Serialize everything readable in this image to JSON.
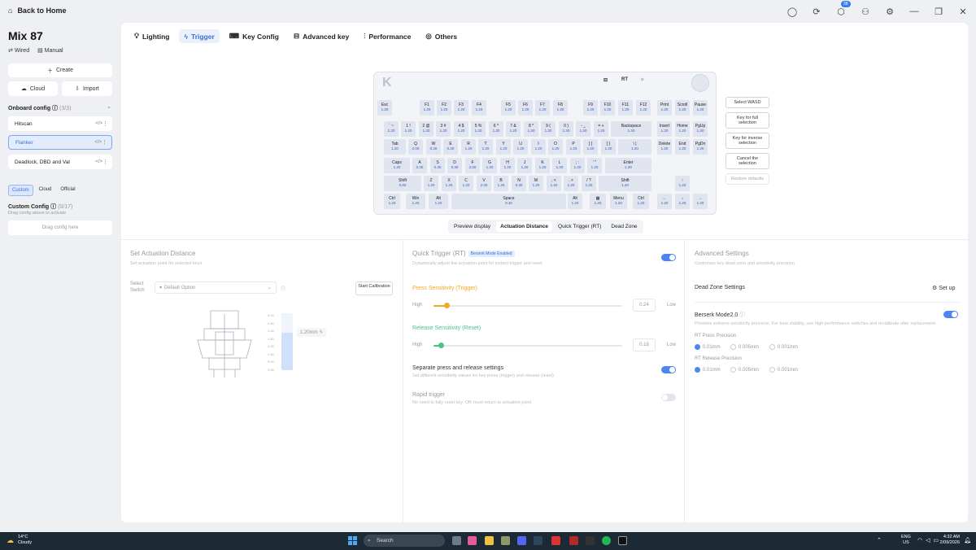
{
  "titlebar": {
    "back_label": "Back to Home",
    "notification_count": "38"
  },
  "sidebar": {
    "device_name": "Mix 87",
    "connection": "Wired",
    "manual": "Manual",
    "create_label": "Create",
    "cloud_label": "Cloud",
    "import_label": "Import",
    "onboard_config_label": "Onboard config",
    "onboard_config_count": "(3/3)",
    "configs": [
      "Hitscan",
      "Flanker",
      "Deadlock, DBD and Val"
    ],
    "filter_tabs": [
      "Custom",
      "Cloud",
      "Official"
    ],
    "custom_config_label": "Custom Config",
    "custom_config_count": "(0/17)",
    "custom_config_hint": "Drag config above to activate",
    "drag_hint": "Drag config here"
  },
  "tabs": [
    "Lighting",
    "Trigger",
    "Key Config",
    "Advanced key",
    "Performance",
    "Others"
  ],
  "keyboard": {
    "icon_labels": [
      "⊟",
      "RT",
      "☼"
    ],
    "rows": [
      [
        [
          "Esc",
          "1.20"
        ],
        [
          "F1",
          "1.20"
        ],
        [
          "F2",
          "1.20"
        ],
        [
          "F3",
          "1.20"
        ],
        [
          "F4",
          "1.20"
        ],
        [
          "F5",
          "1.20"
        ],
        [
          "F6",
          "1.20"
        ],
        [
          "F7",
          "1.20"
        ],
        [
          "F8",
          "1.20"
        ],
        [
          "F9",
          "1.20"
        ],
        [
          "F10",
          "1.20"
        ],
        [
          "F11",
          "1.20"
        ],
        [
          "F12",
          "1.20"
        ],
        [
          "Print",
          "1.20"
        ],
        [
          "Scroll",
          "1.20"
        ],
        [
          "Pause",
          "1.20"
        ]
      ],
      [
        [
          "` ~",
          "1.20"
        ],
        [
          "1 !",
          "1.20"
        ],
        [
          "2 @",
          "1.20"
        ],
        [
          "3 #",
          "1.20"
        ],
        [
          "4 $",
          "1.20"
        ],
        [
          "5 %",
          "1.20"
        ],
        [
          "6 ^",
          "1.20"
        ],
        [
          "7 &",
          "1.20"
        ],
        [
          "8 *",
          "1.20"
        ],
        [
          "9 (",
          "1.20"
        ],
        [
          "0 )",
          "1.20"
        ],
        [
          "- _",
          "1.20"
        ],
        [
          "= +",
          "1.20"
        ],
        [
          "Backspace",
          "1.20"
        ],
        [
          "Insert",
          "1.20"
        ],
        [
          "Home",
          "1.20"
        ],
        [
          "PgUp",
          "1.20"
        ]
      ],
      [
        [
          "Tab",
          "1.20"
        ],
        [
          "Q",
          "2.00"
        ],
        [
          "W",
          "0.30"
        ],
        [
          "E",
          "0.40"
        ],
        [
          "R",
          "1.20"
        ],
        [
          "T",
          "1.20"
        ],
        [
          "Y",
          "1.20"
        ],
        [
          "U",
          "1.20"
        ],
        [
          "I",
          "1.20"
        ],
        [
          "O",
          "1.20"
        ],
        [
          "P",
          "1.20"
        ],
        [
          "[ {",
          "1.20"
        ],
        [
          "] }",
          "1.20"
        ],
        [
          "\\ |",
          "1.20"
        ],
        [
          "Delete",
          "1.20"
        ],
        [
          "End",
          "1.20"
        ],
        [
          "PgDn",
          "1.20"
        ]
      ],
      [
        [
          "Caps",
          "1.20"
        ],
        [
          "A",
          "0.30"
        ],
        [
          "S",
          "0.30"
        ],
        [
          "D",
          "0.30"
        ],
        [
          "F",
          "2.00"
        ],
        [
          "G",
          "1.20"
        ],
        [
          "H",
          "1.20"
        ],
        [
          "J",
          "1.20"
        ],
        [
          "K",
          "1.20"
        ],
        [
          "L",
          "1.20"
        ],
        [
          "; :",
          "1.20"
        ],
        [
          "' \"",
          "1.20"
        ],
        [
          "Enter",
          "1.20"
        ]
      ],
      [
        [
          "Shift",
          "0.60"
        ],
        [
          "Z",
          "1.20"
        ],
        [
          "X",
          "1.20"
        ],
        [
          "C",
          "1.20"
        ],
        [
          "V",
          "2.00"
        ],
        [
          "B",
          "1.20"
        ],
        [
          "N",
          "0.30"
        ],
        [
          "M",
          "1.20"
        ],
        [
          ", <",
          "1.20"
        ],
        [
          ". >",
          "1.20"
        ],
        [
          "/ ?",
          "1.20"
        ],
        [
          "Shift",
          "1.20"
        ],
        [
          "↑",
          "1.20"
        ]
      ],
      [
        [
          "Ctrl",
          "1.20"
        ],
        [
          "Win",
          "1.20"
        ],
        [
          "Alt",
          "1.20"
        ],
        [
          "Space",
          "0.40"
        ],
        [
          "Alt",
          "1.20"
        ],
        [
          "▦",
          "1.20"
        ],
        [
          "Menu",
          "1.20"
        ],
        [
          "Ctrl",
          "1.20"
        ],
        [
          "←",
          "1.20"
        ],
        [
          "↓",
          "1.20"
        ],
        [
          "→",
          "1.20"
        ]
      ]
    ]
  },
  "side_buttons": [
    "Select WASD",
    "Key for full selection",
    "Key for inverse selection",
    "Cancel the selection",
    "Restore defaults"
  ],
  "view_tabs": [
    "Preview display",
    "Actuation Distance",
    "Quick Trigger (RT)",
    "Dead Zone"
  ],
  "actuation": {
    "title": "Set Actuation Distance",
    "subtitle": "Set actuation point for selected keys",
    "select_label": "Select Switch",
    "select_value": "Default Option",
    "calibration_btn": "Start Calibration",
    "scale": [
      "0.00",
      "0.50",
      "1.00",
      "1.50",
      "2.00",
      "2.50",
      "3.00",
      "3.50"
    ],
    "value_label": "1.20mm"
  },
  "quick_trigger": {
    "title": "Quick Trigger (RT)",
    "badge": "Berserk Mode Enabled",
    "subtitle": "Dynamically adjust the actuation point for instant trigger and reset",
    "press_label": "Press Sensitivity (Trigger)",
    "press_value": "0.24",
    "release_label": "Release Sensitivity (Reset)",
    "release_value": "0.18",
    "high": "High",
    "low": "Low",
    "sep_title": "Separate press and release settings",
    "sep_sub": "Set different sensitivity values for key press (trigger) and release (reset)",
    "rapid_title": "Rapid trigger",
    "rapid_sub": "No need to fully reset key. Off: must return to actuation point",
    "rt_enabled": true,
    "sep_enabled": true,
    "rapid_enabled": false,
    "press_fraction": 0.07,
    "release_fraction": 0.04
  },
  "advanced": {
    "title": "Advanced Settings",
    "subtitle": "Customize key dead zone and sensitivity precision",
    "dead_zone": "Dead Zone Settings",
    "setup": "Set up",
    "berserk_title": "Berserk Mode2.0",
    "berserk_sub": "Provides extreme sensitivity precision. For best stability, use high-performance switches and recalibrate after replacement.",
    "press_precision": "RT Press Precision",
    "release_precision": "RT Release Precision",
    "options": [
      "0.01mm",
      "0.005mm",
      "0.001mm"
    ],
    "berserk_enabled": true
  },
  "taskbar": {
    "temp": "14°C",
    "weather": "Cloudy",
    "search": "Search",
    "lang": "ENG",
    "region": "US",
    "time": "4:32 AM",
    "date": "2/09/2026"
  },
  "colors": {
    "accent": "#3b6fd8",
    "toggle": "#4d86f0",
    "slider": "#f5a623",
    "slider_release": "#4cc28a"
  }
}
